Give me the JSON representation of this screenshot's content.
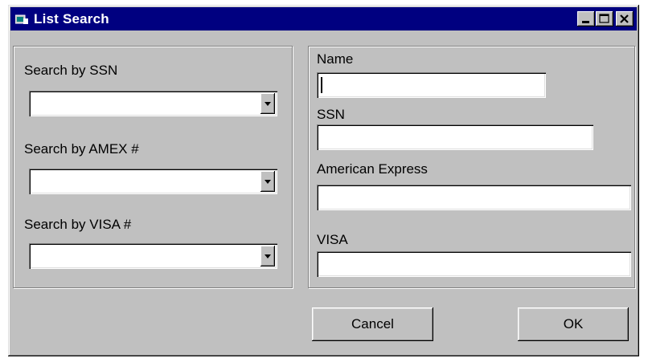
{
  "window": {
    "title": "List Search",
    "minimize_label": "_",
    "maximize_label": "□",
    "close_label": "×"
  },
  "search_panel": {
    "ssn_label": "Search by SSN",
    "amex_label": "Search by AMEX #",
    "visa_label": "Search by VISA #",
    "ssn_value": "",
    "amex_value": "",
    "visa_value": ""
  },
  "details_panel": {
    "name_label": "Name",
    "ssn_label": "SSN",
    "amex_label": "American Express",
    "visa_label": "VISA",
    "name_value": "",
    "ssn_value": "",
    "amex_value": "",
    "visa_value": ""
  },
  "buttons": {
    "cancel": "Cancel",
    "ok": "OK"
  },
  "colors": {
    "titlebar": "#000080",
    "face": "#c0c0c0"
  }
}
